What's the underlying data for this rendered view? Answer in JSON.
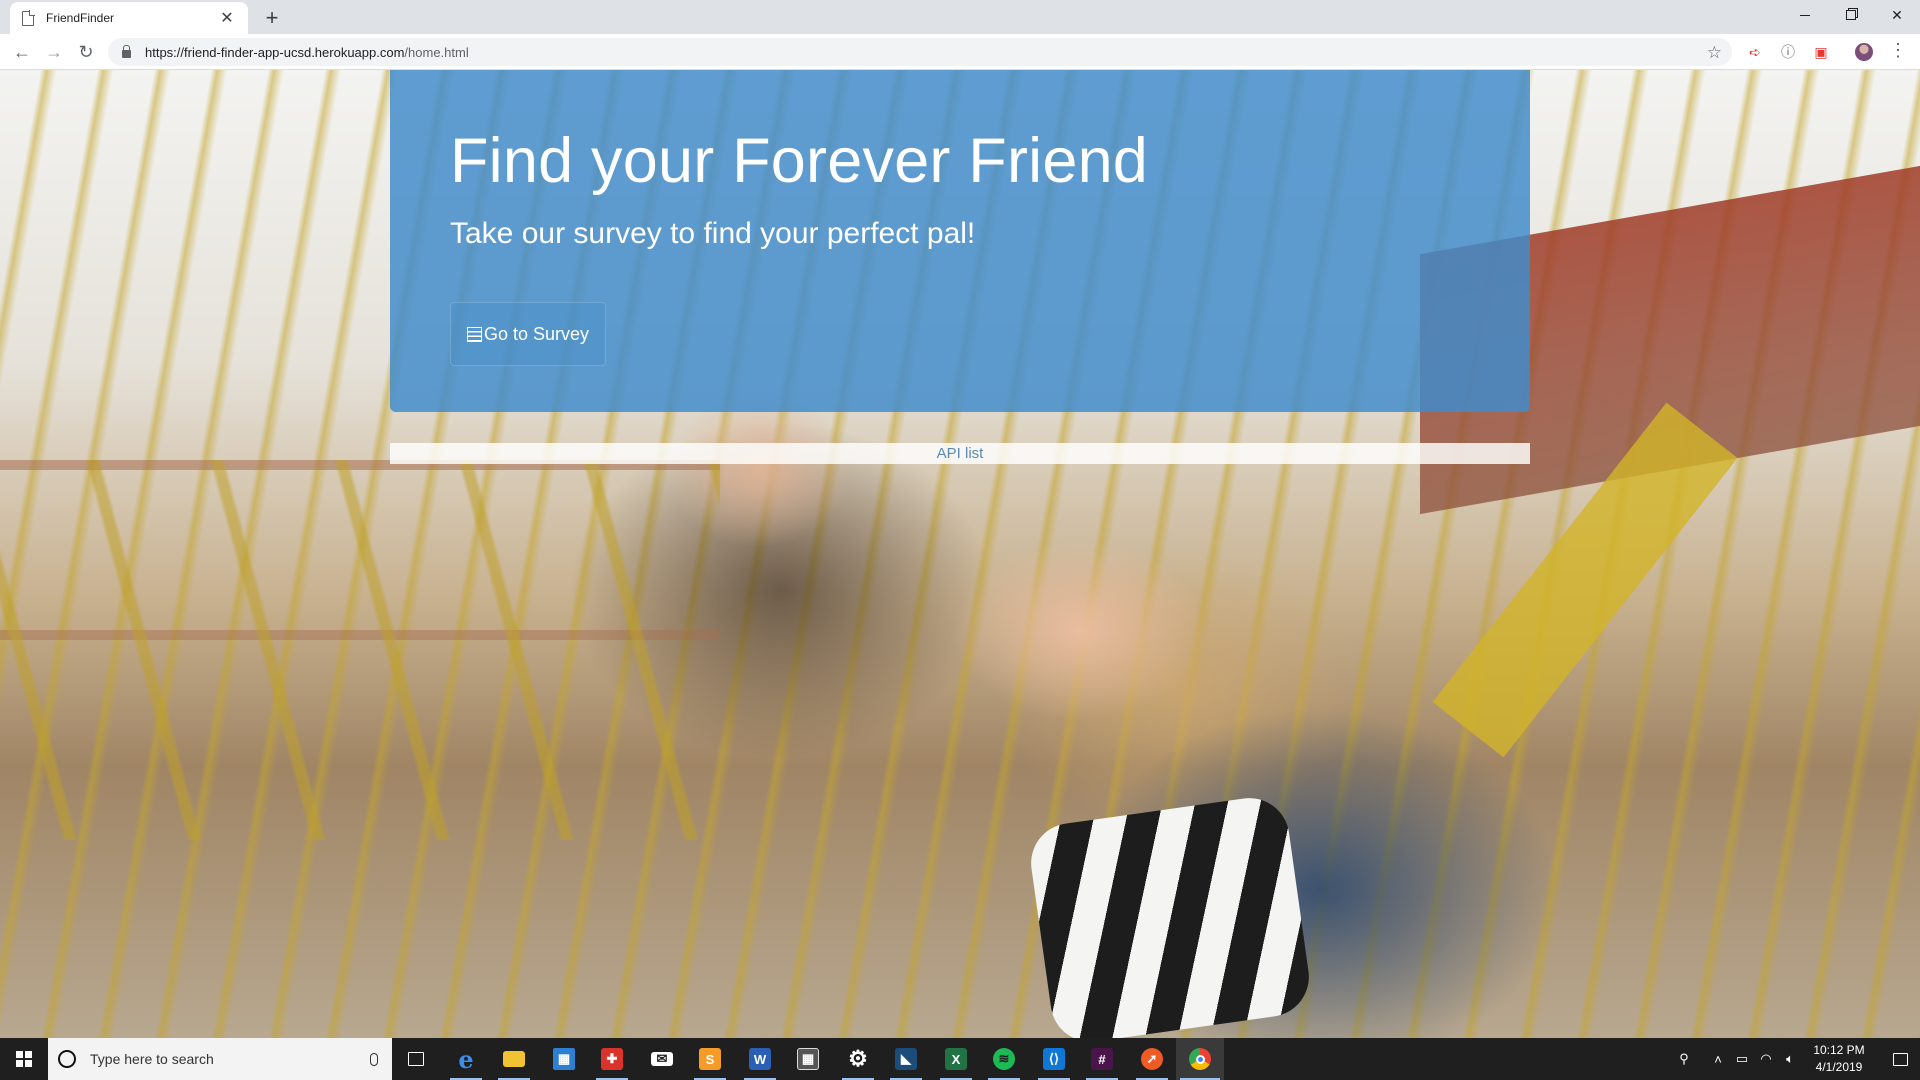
{
  "browser": {
    "tab_title": "FriendFinder",
    "url_host": "https://friend-finder-app-ucsd.herokuapp.com",
    "url_path": "/home.html"
  },
  "page": {
    "hero_title": "Find your Forever Friend",
    "hero_subtitle": "Take our survey to find your perfect pal!",
    "survey_button_label": "Go to Survey",
    "api_link_label": "API list",
    "accent_color": "#428bca"
  },
  "taskbar": {
    "search_placeholder": "Type here to search",
    "clock_time": "10:12 PM",
    "clock_date": "4/1/2019",
    "apps": [
      {
        "name": "task-view-icon"
      },
      {
        "name": "edge-icon",
        "letter": "e",
        "color": "#1e73d2"
      },
      {
        "name": "file-explorer-icon",
        "color": "#f1c232"
      },
      {
        "name": "store-icon",
        "color": "#2d7fd3"
      },
      {
        "name": "gift-app-icon",
        "color": "#d9342b"
      },
      {
        "name": "mail-icon",
        "color": "#ffffff"
      },
      {
        "name": "sublime-text-icon",
        "letter": "S",
        "color": "#f59b28"
      },
      {
        "name": "word-icon",
        "letter": "W",
        "color": "#2b5fb4"
      },
      {
        "name": "calculator-icon",
        "color": "#444444"
      },
      {
        "name": "settings-icon",
        "letter": "⚙",
        "color": "#1f1f1f"
      },
      {
        "name": "visual-studio-icon",
        "color": "#1c4d7a"
      },
      {
        "name": "excel-icon",
        "letter": "X",
        "color": "#217346"
      },
      {
        "name": "spotify-icon",
        "color": "#1db954"
      },
      {
        "name": "vscode-icon",
        "color": "#0e78d4"
      },
      {
        "name": "slack-icon",
        "color": "#4a154b"
      },
      {
        "name": "postman-icon",
        "color": "#ef5b25"
      },
      {
        "name": "chrome-icon",
        "color": "#4285f4"
      }
    ]
  }
}
